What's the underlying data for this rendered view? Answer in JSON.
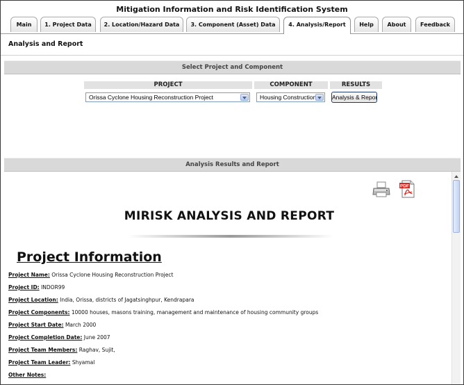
{
  "app": {
    "title": "Mitigation Information and Risk Identification System"
  },
  "tabs": [
    {
      "label": "Main"
    },
    {
      "label": "1. Project Data"
    },
    {
      "label": "2. Location/Hazard Data"
    },
    {
      "label": "3. Component (Asset) Data"
    },
    {
      "label": "4. Analysis/Report"
    },
    {
      "label": "Help"
    },
    {
      "label": "About"
    },
    {
      "label": "Feedback"
    }
  ],
  "page": {
    "heading": "Analysis and Report"
  },
  "select_section": {
    "title": "Select Project and Component",
    "headers": {
      "project": "PROJECT",
      "component": "COMPONENT",
      "results": "RESULTS"
    },
    "project_value": "Orissa Cyclone Housing Reconstruction Project",
    "component_value": "Housing Construction",
    "results_button": "Analysis & Report"
  },
  "results_section": {
    "title": "Analysis Results and Report"
  },
  "report": {
    "title": "MIRISK ANALYSIS AND REPORT",
    "pdf_icon_text": "PDF",
    "section_title": "Project Information",
    "fields": [
      {
        "label": "Project Name:",
        "value": "Orissa Cyclone Housing Reconstruction Project"
      },
      {
        "label": "Project ID:",
        "value": "INDOR99"
      },
      {
        "label": "Project Location:",
        "value": "India, Orissa, districts of Jagatsinghpur, Kendrapara"
      },
      {
        "label": "Project Components:",
        "value": "10000 houses, masons training, management and maintenance of housing community groups"
      },
      {
        "label": "Project Start Date:",
        "value": "March 2000"
      },
      {
        "label": "Project Completion Date:",
        "value": "June 2007"
      },
      {
        "label": "Project Team Members:",
        "value": "Raghav, Sujit,"
      },
      {
        "label": "Project Team Leader:",
        "value": "Shyamal"
      },
      {
        "label": "Other Notes:",
        "value": ""
      }
    ]
  },
  "colors": {
    "band": "#d9d9d9",
    "select_border": "#7f9db9",
    "button_border": "#1f3c70",
    "pdf_red": "#d8251d"
  }
}
